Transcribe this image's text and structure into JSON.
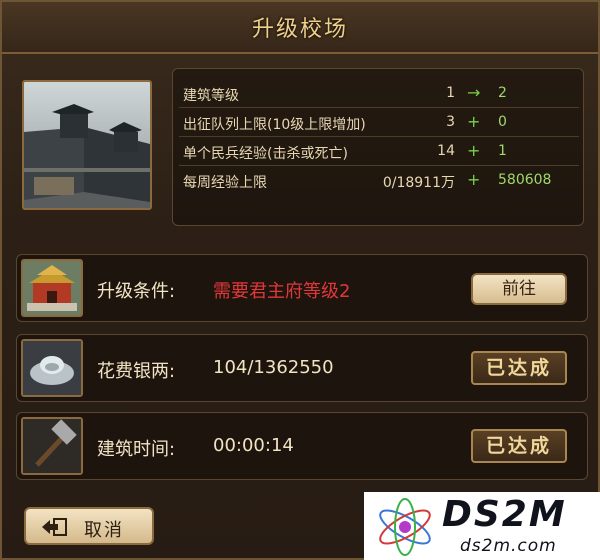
{
  "window": {
    "title": "升级校场"
  },
  "stats": [
    {
      "label": "建筑等级",
      "current": "1",
      "op": "→",
      "next": "2"
    },
    {
      "label": "出征队列上限(10级上限增加)",
      "current": "3",
      "op": "+",
      "next": "0"
    },
    {
      "label": "单个民兵经验(击杀或死亡)",
      "current": "14",
      "op": "+",
      "next": "1"
    },
    {
      "label": "每周经验上限",
      "current": "0/18911万",
      "op": "+",
      "next": "580608"
    }
  ],
  "requirements": [
    {
      "label": "升级条件:",
      "value": "需要君主府等级2",
      "action": "前往",
      "icon": "palace-icon"
    },
    {
      "label": "花费银两:",
      "value": "104/1362550",
      "action": "已达成",
      "icon": "silver-ingot-icon"
    },
    {
      "label": "建筑时间:",
      "value": "00:00:14",
      "action": "已达成",
      "icon": "hammer-icon"
    }
  ],
  "footer": {
    "cancel_label": "取消"
  },
  "watermark": {
    "big": "DS2M",
    "small": "ds2m.com"
  },
  "colors": {
    "accent_gold": "#f0cf8b",
    "green": "#9fd86b",
    "red": "#e2373a"
  }
}
